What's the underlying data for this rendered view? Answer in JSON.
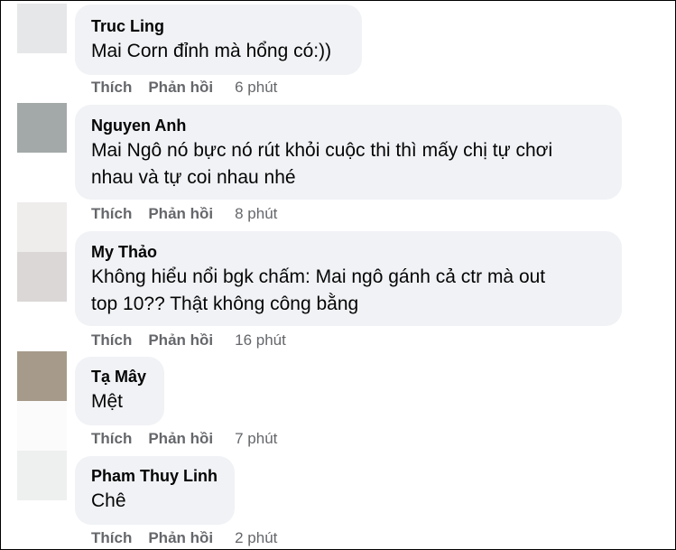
{
  "comments": [
    {
      "name": "Truc Ling",
      "text": [
        "Mai Corn đỉnh mà hổng có:))"
      ],
      "like": "Thích",
      "reply": "Phản hồi",
      "time": "6 phút"
    },
    {
      "name": "Nguyen Anh",
      "text": [
        "Mai Ngô nó bực nó rút khỏi cuộc thi thì mấy chị tự chơi",
        "nhau và tự coi nhau nhé"
      ],
      "like": "Thích",
      "reply": "Phản hồi",
      "time": "8 phút"
    },
    {
      "name": "My Thảo",
      "text": [
        "Không hiểu nổi bgk chấm: Mai ngô gánh cả ctr mà out",
        "top 10?? Thật không công bằng"
      ],
      "like": "Thích",
      "reply": "Phản hồi",
      "time": "16 phút"
    },
    {
      "name": "Tạ Mây",
      "text": [
        "Mệt"
      ],
      "like": "Thích",
      "reply": "Phản hồi",
      "time": "7 phút"
    },
    {
      "name": "Pham Thuy Linh",
      "text": [
        "Chê"
      ],
      "like": "Thích",
      "reply": "Phản hồi",
      "time": "2 phút"
    }
  ],
  "colors": {
    "bubble_bg": "#f0f2f5",
    "name_text": "#050505",
    "meta_text": "#65676b"
  }
}
